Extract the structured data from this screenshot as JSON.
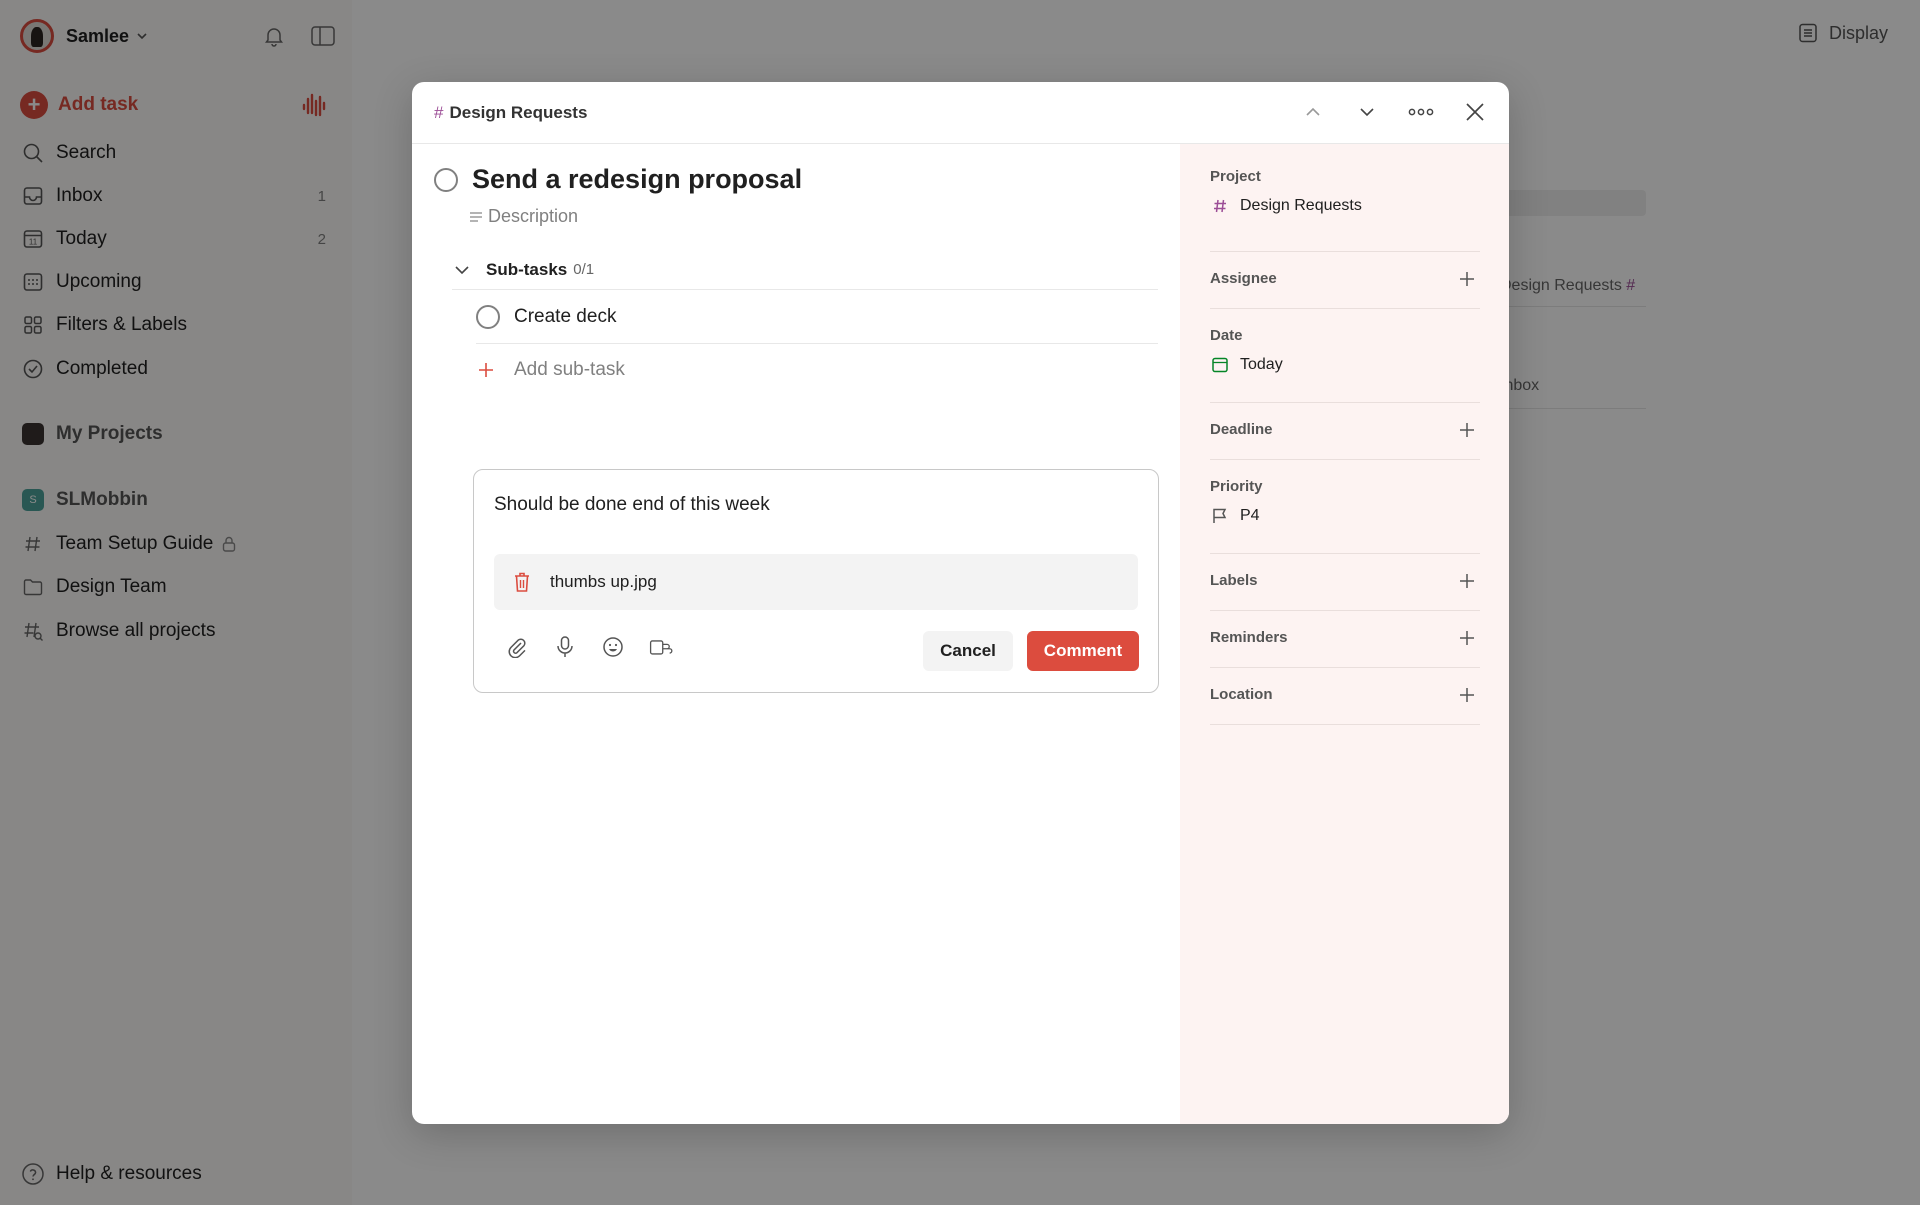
{
  "sidebar": {
    "user_name": "Samlee",
    "add_task": "Add task",
    "nav": [
      {
        "label": "Search",
        "count": ""
      },
      {
        "label": "Inbox",
        "count": "1"
      },
      {
        "label": "Today",
        "count": "2"
      },
      {
        "label": "Upcoming",
        "count": ""
      },
      {
        "label": "Filters & Labels",
        "count": ""
      },
      {
        "label": "Completed",
        "count": ""
      }
    ],
    "today_date": "11",
    "my_projects": "My Projects",
    "workspace": "SLMobbin",
    "workspace_badge": "S",
    "projects": [
      {
        "label": "Team Setup Guide"
      },
      {
        "label": "Design Team"
      },
      {
        "label": "Browse all projects"
      }
    ],
    "help": "Help & resources"
  },
  "main": {
    "display_label": "Display",
    "bg_rows": [
      "Design Requests",
      "Inbox"
    ]
  },
  "modal": {
    "breadcrumb_hash": "#",
    "breadcrumb": "Design Requests",
    "task_title": "Send a redesign proposal",
    "description_placeholder": "Description",
    "subtasks_label": "Sub-tasks",
    "subtasks_count": "0/1",
    "subtasks": [
      {
        "label": "Create deck"
      }
    ],
    "add_subtask": "Add sub-task",
    "comment_text": "Should be done end of this week",
    "attachment_name": "thumbs up.jpg",
    "cancel_label": "Cancel",
    "comment_label": "Comment"
  },
  "details": {
    "project_label": "Project",
    "project_value": "Design Requests",
    "assignee_label": "Assignee",
    "date_label": "Date",
    "date_value": "Today",
    "deadline_label": "Deadline",
    "priority_label": "Priority",
    "priority_value": "P4",
    "labels_label": "Labels",
    "reminders_label": "Reminders",
    "location_label": "Location"
  },
  "colors": {
    "accent": "#dc4c3e",
    "project_hash": "#9b4d96",
    "date_green": "#058527",
    "panel_bg": "#fdf3f2"
  },
  "icons": [
    "bell-icon",
    "sidebar-toggle-icon",
    "search-icon",
    "inbox-icon",
    "calendar-icon",
    "upcoming-icon",
    "filters-icon",
    "check-circle-icon",
    "folder-icon",
    "hash-icon",
    "lock-icon",
    "help-icon",
    "chevron-up-icon",
    "chevron-down-icon",
    "more-icon",
    "close-icon",
    "paperclip-icon",
    "mic-icon",
    "emoji-icon",
    "link-icon",
    "trash-icon",
    "flag-icon",
    "plus-icon",
    "display-icon",
    "soundwave-icon"
  ]
}
